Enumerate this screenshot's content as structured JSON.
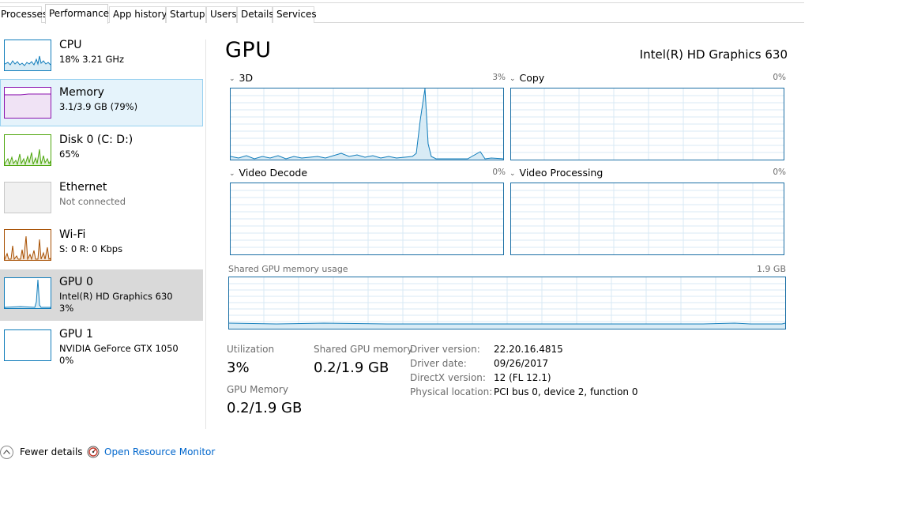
{
  "tabs": [
    {
      "label": "Processes"
    },
    {
      "label": "Performance"
    },
    {
      "label": "App history"
    },
    {
      "label": "Startup"
    },
    {
      "label": "Users"
    },
    {
      "label": "Details"
    },
    {
      "label": "Services"
    }
  ],
  "sidebar": {
    "items": [
      {
        "title": "CPU",
        "sub1": "18%  3.21 GHz",
        "sub2": ""
      },
      {
        "title": "Memory",
        "sub1": "3.1/3.9 GB (79%)",
        "sub2": ""
      },
      {
        "title": "Disk 0 (C: D:)",
        "sub1": "65%",
        "sub2": ""
      },
      {
        "title": "Ethernet",
        "sub1": "Not connected",
        "sub2": ""
      },
      {
        "title": "Wi-Fi",
        "sub1": "S: 0  R: 0 Kbps",
        "sub2": ""
      },
      {
        "title": "GPU 0",
        "sub1": "Intel(R) HD Graphics 630",
        "sub2": "3%"
      },
      {
        "title": "GPU 1",
        "sub1": "NVIDIA GeForce GTX 1050",
        "sub2": "0%"
      }
    ]
  },
  "main": {
    "title": "GPU",
    "device_name": "Intel(R) HD Graphics 630",
    "engines": [
      {
        "label": "3D",
        "percent": "3%"
      },
      {
        "label": "Copy",
        "percent": "0%"
      },
      {
        "label": "Video Decode",
        "percent": "0%"
      },
      {
        "label": "Video Processing",
        "percent": "0%"
      }
    ],
    "shared_memory": {
      "label": "Shared GPU memory usage",
      "max": "1.9 GB"
    },
    "stats": {
      "utilization_label": "Utilization",
      "utilization_value": "3%",
      "shared_label": "Shared GPU memory",
      "shared_value": "0.2/1.9 GB",
      "gpu_memory_label": "GPU Memory",
      "gpu_memory_value": "0.2/1.9 GB"
    },
    "info": [
      {
        "label": "Driver version:",
        "value": "22.20.16.4815"
      },
      {
        "label": "Driver date:",
        "value": "09/26/2017"
      },
      {
        "label": "DirectX version:",
        "value": "12 (FL 12.1)"
      },
      {
        "label": "Physical location:",
        "value": "PCI bus 0, device 2, function 0"
      }
    ]
  },
  "footer": {
    "fewer_details": "Fewer details",
    "open_resource_monitor": "Open Resource Monitor"
  },
  "colors": {
    "cpu": "#117dbb",
    "memory": "#8b12ae",
    "disk": "#4da60c",
    "ethernet": "#a7a7a7",
    "wifi": "#a74f01",
    "gpu": "#117dbb"
  },
  "icons": {
    "fewer_details": "chevron-up-icon",
    "resource_monitor": "resource-monitor-icon"
  }
}
